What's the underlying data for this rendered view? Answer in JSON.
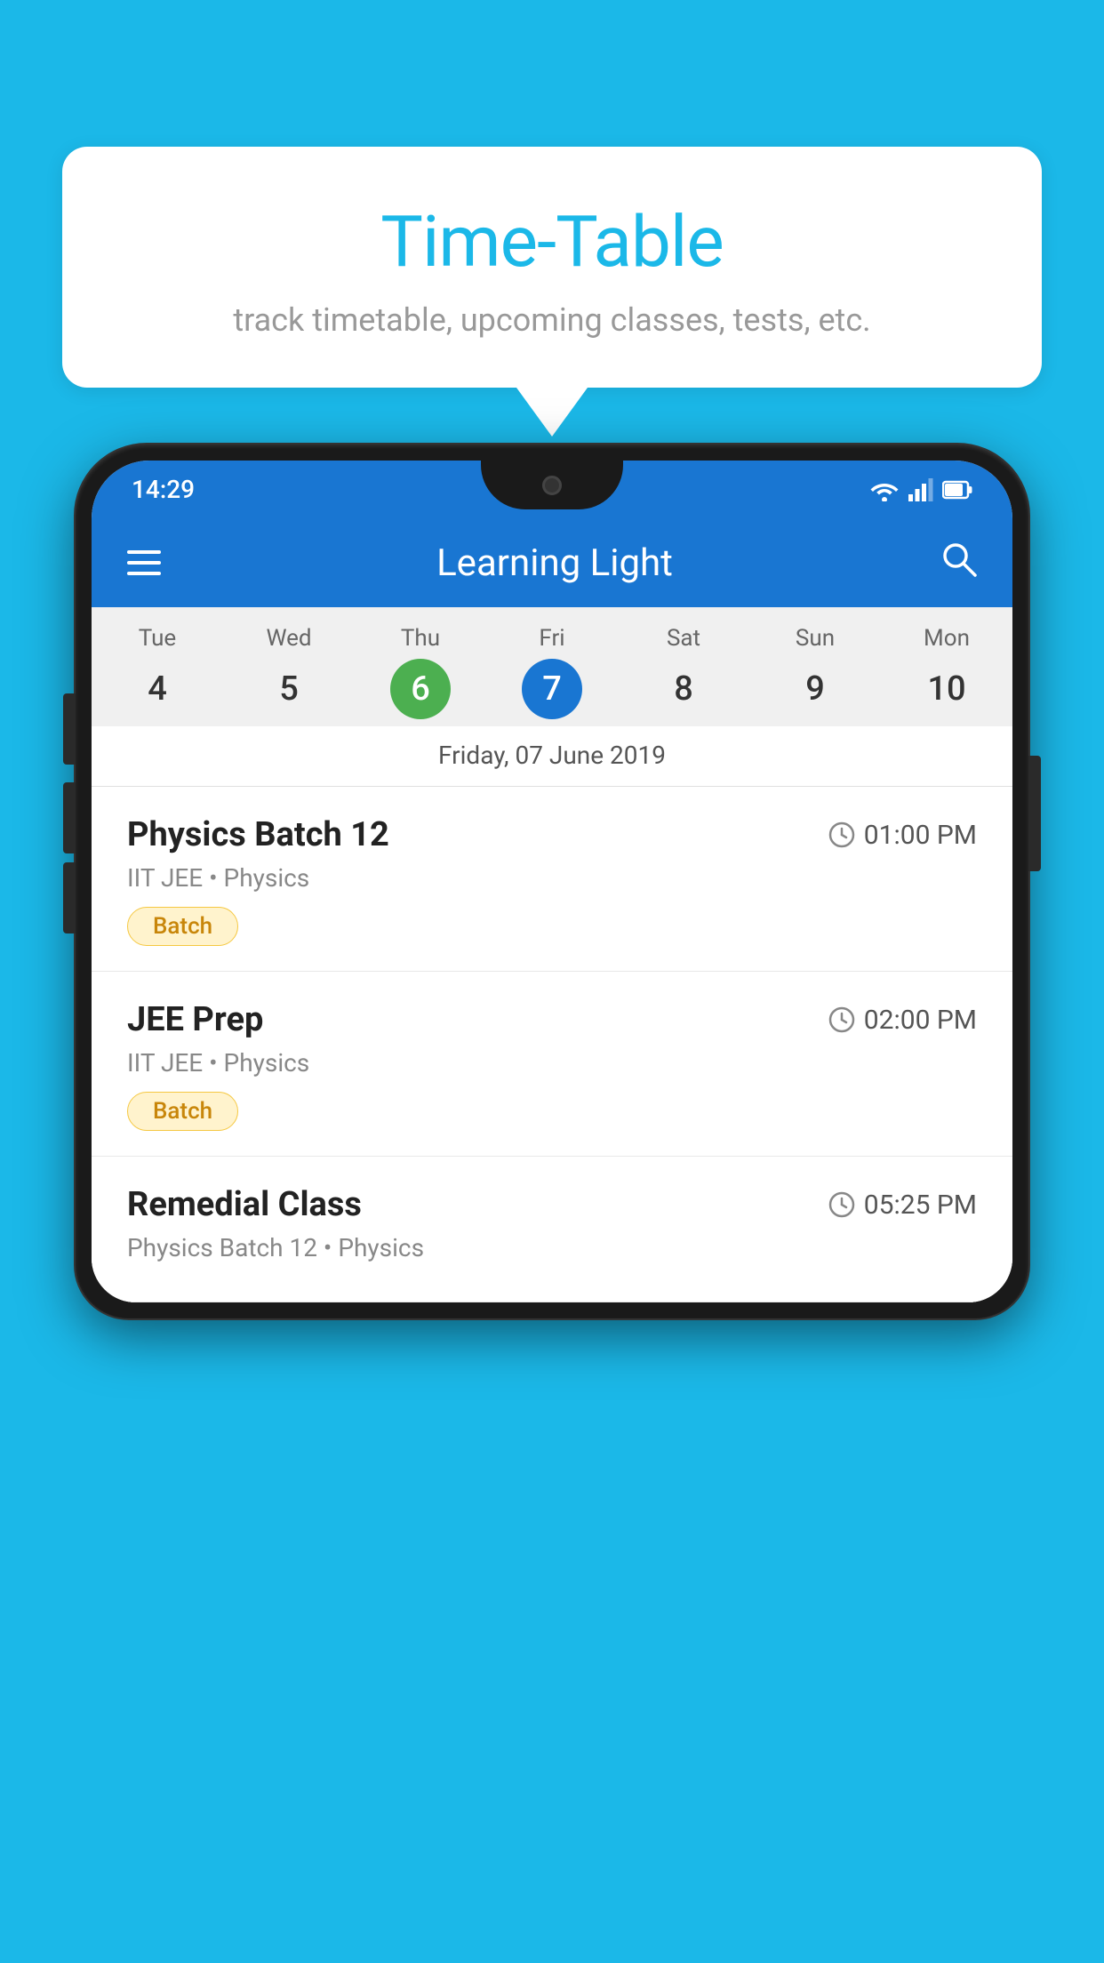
{
  "page": {
    "background_color": "#1BB8E8"
  },
  "speech_bubble": {
    "title": "Time-Table",
    "subtitle": "track timetable, upcoming classes, tests, etc."
  },
  "phone": {
    "status_bar": {
      "time": "14:29"
    },
    "app_bar": {
      "title": "Learning Light"
    },
    "calendar": {
      "days": [
        {
          "name": "Tue",
          "num": "4",
          "state": "normal"
        },
        {
          "name": "Wed",
          "num": "5",
          "state": "normal"
        },
        {
          "name": "Thu",
          "num": "6",
          "state": "today"
        },
        {
          "name": "Fri",
          "num": "7",
          "state": "selected"
        },
        {
          "name": "Sat",
          "num": "8",
          "state": "normal"
        },
        {
          "name": "Sun",
          "num": "9",
          "state": "normal"
        },
        {
          "name": "Mon",
          "num": "10",
          "state": "normal"
        }
      ],
      "selected_date_label": "Friday, 07 June 2019"
    },
    "classes": [
      {
        "name": "Physics Batch 12",
        "time": "01:00 PM",
        "subject": "IIT JEE • Physics",
        "badge": "Batch"
      },
      {
        "name": "JEE Prep",
        "time": "02:00 PM",
        "subject": "IIT JEE • Physics",
        "badge": "Batch"
      },
      {
        "name": "Remedial Class",
        "time": "05:25 PM",
        "subject": "Physics Batch 12 • Physics",
        "badge": null
      }
    ]
  }
}
